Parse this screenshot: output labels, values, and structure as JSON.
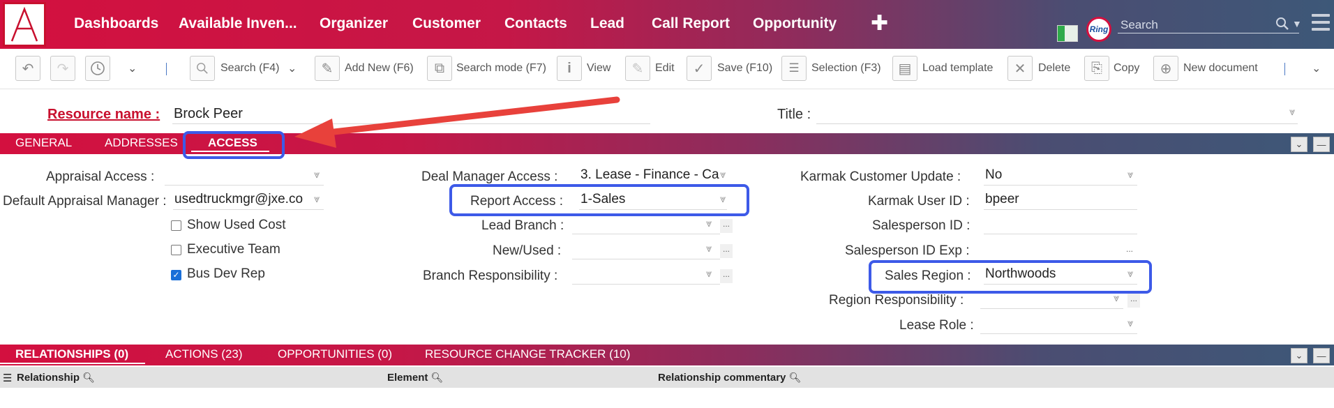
{
  "nav": {
    "logo_letter": "A",
    "items": [
      "Dashboards",
      "Available Inven...",
      "Organizer",
      "Customer",
      "Contacts",
      "Lead",
      "Call Report",
      "Opportunity"
    ],
    "plus": "✚",
    "ring": "Ring",
    "search_placeholder": "Search"
  },
  "toolbar": {
    "search": "Search (F4)",
    "add_new": "Add New (F6)",
    "search_mode": "Search mode (F7)",
    "view": "View",
    "edit": "Edit",
    "save": "Save (F10)",
    "selection": "Selection (F3)",
    "load_template": "Load template",
    "delete": "Delete",
    "copy": "Copy",
    "new_document": "New document"
  },
  "resource": {
    "name_label": "Resource name :",
    "name_value": "Brock Peer",
    "title_label": "Title :",
    "title_value": ""
  },
  "tabs": {
    "items": [
      "GENERAL",
      "ADDRESSES",
      "ACCESS"
    ],
    "active": "ACCESS"
  },
  "access": {
    "appraisal_access_label": "Appraisal Access :",
    "appraisal_access_value": "",
    "default_appraisal_manager_label": "Default Appraisal Manager :",
    "default_appraisal_manager_value": "usedtruckmgr@jxe.co",
    "show_used_cost_label": "Show Used Cost",
    "show_used_cost": false,
    "executive_team_label": "Executive Team",
    "executive_team": false,
    "bus_dev_rep_label": "Bus Dev Rep",
    "bus_dev_rep": true,
    "deal_manager_access_label": "Deal Manager Access :",
    "deal_manager_access_value": "3. Lease - Finance - Ca",
    "report_access_label": "Report Access :",
    "report_access_value": "1-Sales",
    "lead_branch_label": "Lead Branch :",
    "lead_branch_value": "",
    "new_used_label": "New/Used :",
    "new_used_value": "",
    "branch_responsibility_label": "Branch Responsibility :",
    "branch_responsibility_value": "",
    "karmak_customer_update_label": "Karmak Customer Update :",
    "karmak_customer_update_value": "No",
    "karmak_user_id_label": "Karmak User ID :",
    "karmak_user_id_value": "bpeer",
    "salesperson_id_label": "Salesperson ID :",
    "salesperson_id_value": "",
    "salesperson_id_exp_label": "Salesperson ID Exp :",
    "salesperson_id_exp_value": "",
    "sales_region_label": "Sales Region :",
    "sales_region_value": "Northwoods",
    "region_responsibility_label": "Region Responsibility :",
    "region_responsibility_value": "",
    "lease_role_label": "Lease Role :",
    "lease_role_value": ""
  },
  "bottom_tabs": {
    "items": [
      "RELATIONSHIPS (0)",
      "ACTIONS (23)",
      "OPPORTUNITIES (0)",
      "RESOURCE CHANGE TRACKER (10)"
    ],
    "active": "RELATIONSHIPS (0)"
  },
  "grid": {
    "columns": [
      "Relationship",
      "Element",
      "Relationship commentary"
    ]
  },
  "colors": {
    "brand_red": "#d3103f",
    "brand_slate": "#3d5878",
    "highlight": "#3d5ae8",
    "arrow": "#e8413b"
  }
}
